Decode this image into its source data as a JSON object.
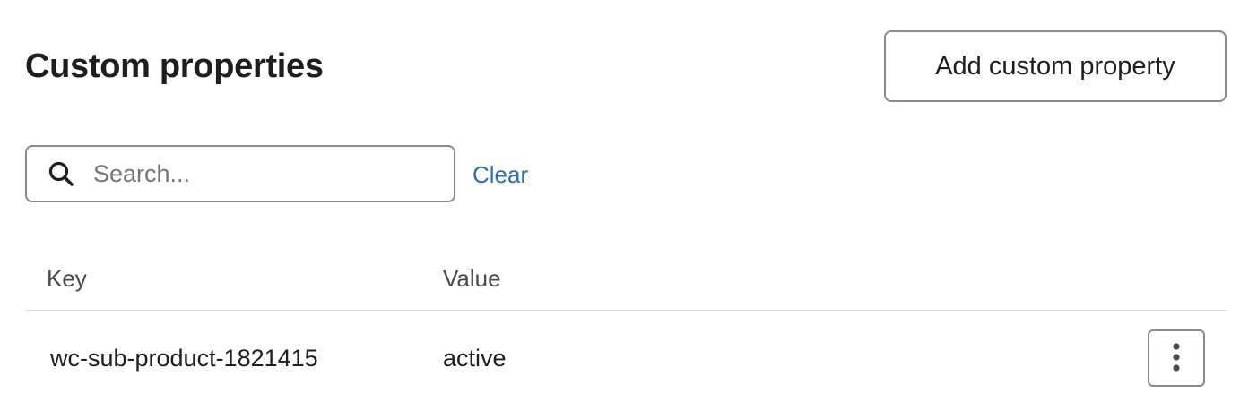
{
  "header": {
    "title": "Custom properties",
    "add_button_label": "Add custom property"
  },
  "search": {
    "placeholder": "Search...",
    "value": "",
    "clear_label": "Clear",
    "icon": "search-icon"
  },
  "table": {
    "columns": [
      "Key",
      "Value"
    ],
    "rows": [
      {
        "key": "wc-sub-product-1821415",
        "value": "active",
        "menu_icon": "kebab-menu-icon"
      }
    ]
  },
  "colors": {
    "text": "#1e1e1e",
    "link": "#2f6db3",
    "border": "#8a8a8a",
    "divider": "#dcdcdc",
    "placeholder": "#757575"
  }
}
